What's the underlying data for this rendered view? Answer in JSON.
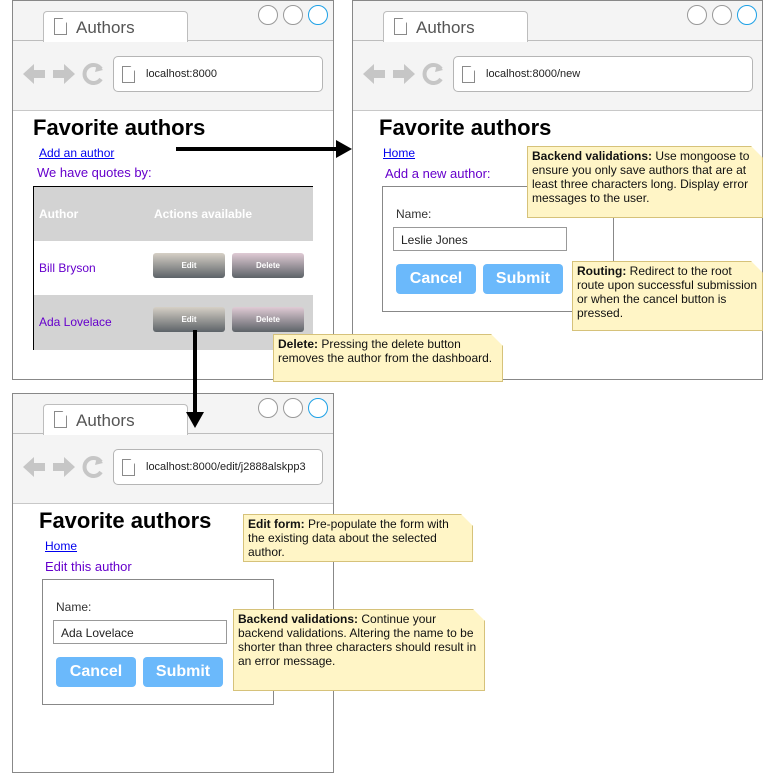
{
  "windows": {
    "list": {
      "tab_title": "Authors",
      "url": "localhost:8000",
      "heading": "Favorite authors",
      "add_link": "Add an author",
      "subheading": "We have quotes by:",
      "table": {
        "headers": [
          "Author",
          "Actions available"
        ],
        "rows": [
          {
            "author": "Bill Bryson",
            "edit": "Edit",
            "delete": "Delete"
          },
          {
            "author": "Ada Lovelace",
            "edit": "Edit",
            "delete": "Delete"
          }
        ]
      }
    },
    "new": {
      "tab_title": "Authors",
      "url": "localhost:8000/new",
      "heading": "Favorite authors",
      "home_link": "Home",
      "subheading": "Add a new author:",
      "name_label": "Name:",
      "name_value": "Leslie Jones",
      "cancel": "Cancel",
      "submit": "Submit"
    },
    "edit": {
      "tab_title": "Authors",
      "url": "localhost:8000/edit/j2888alskpp3",
      "heading": "Favorite authors",
      "home_link": "Home",
      "subheading": "Edit this author",
      "name_label": "Name:",
      "name_value": "Ada Lovelace",
      "cancel": "Cancel",
      "submit": "Submit"
    }
  },
  "notes": {
    "backend_new": {
      "title": "Backend validations:",
      "text": " Use mongoose to ensure you only save authors that are at least three characters long. Display error messages to the user."
    },
    "routing": {
      "title": "Routing:",
      "text": " Redirect to the root route upon successful submission or when the cancel button is pressed."
    },
    "delete": {
      "title": "Delete:",
      "text": " Pressing the delete button removes the author from the dashboard."
    },
    "edit_form": {
      "title": "Edit form:",
      "text": " Pre-populate the form with the existing data about the selected author."
    },
    "backend_edit": {
      "title": "Backend validations:",
      "text": " Continue your backend validations. Altering the name to be shorter than three characters should result in an error message."
    }
  },
  "colors": {
    "link": "#0000ee",
    "purple_text": "#6600cc",
    "button_blue": "#6bb9fb",
    "note_bg": "#fff5c6",
    "header_gray": "#d3d3d3"
  }
}
